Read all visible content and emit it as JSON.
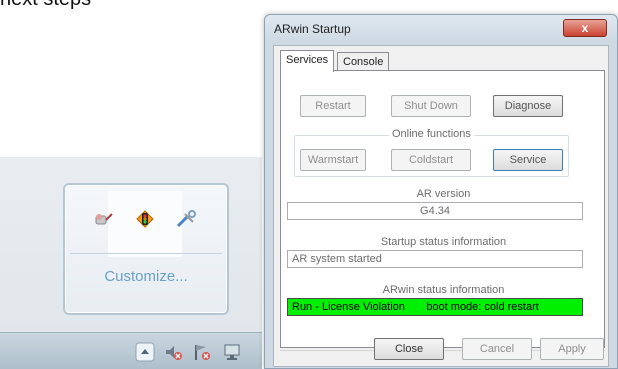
{
  "snippet_text": "next steps",
  "tray": {
    "customize_label": "Customize...",
    "popup_icons": [
      "network-cable-icon",
      "traffic-light-icon",
      "tools-icon"
    ],
    "taskbar_icons": [
      "show-hidden-icons-arrow",
      "speaker-muted-icon",
      "flag-error-icon",
      "network-monitor-icon"
    ]
  },
  "dialog": {
    "title": "ARwin Startup",
    "close_glyph": "x",
    "tabs": [
      {
        "label": "Services",
        "active": true
      },
      {
        "label": "Console",
        "active": false
      }
    ],
    "buttons_row1": {
      "restart": "Restart",
      "shutdown": "Shut Down",
      "diagnose": "Diagnose"
    },
    "online_functions": {
      "legend": "Online functions",
      "warmstart": "Warmstart",
      "coldstart": "Coldstart",
      "service": "Service"
    },
    "ar_version": {
      "label": "AR version",
      "value": "G4.34"
    },
    "startup_status": {
      "label": "Startup status information",
      "value": "AR system started"
    },
    "arwin_status": {
      "label": "ARwin status information",
      "value": "Run - License Violation       boot mode: cold restart",
      "highlight_color": "#00f000"
    },
    "footer": {
      "close": "Close",
      "cancel": "Cancel",
      "apply": "Apply"
    }
  }
}
